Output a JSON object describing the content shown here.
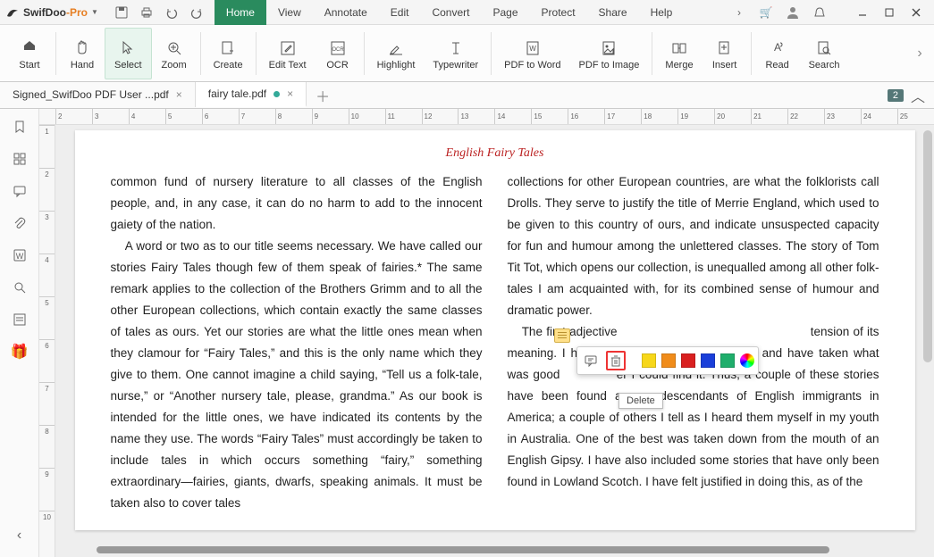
{
  "app": {
    "name1": "SwifDoo",
    "name2": "-Pro"
  },
  "menu": [
    "Home",
    "View",
    "Annotate",
    "Edit",
    "Convert",
    "Page",
    "Protect",
    "Share",
    "Help"
  ],
  "menu_active": 0,
  "ribbon": [
    {
      "label": "Start",
      "icon": "home"
    },
    {
      "label": "Hand",
      "icon": "hand"
    },
    {
      "label": "Select",
      "icon": "cursor",
      "selected": true
    },
    {
      "label": "Zoom",
      "icon": "zoom"
    },
    {
      "label": "Create",
      "icon": "create"
    },
    {
      "label": "Edit Text",
      "icon": "edittext"
    },
    {
      "label": "OCR",
      "icon": "ocr"
    },
    {
      "label": "Highlight",
      "icon": "highlight"
    },
    {
      "label": "Typewriter",
      "icon": "type"
    },
    {
      "label": "PDF to Word",
      "icon": "toword"
    },
    {
      "label": "PDF to Image",
      "icon": "toimg"
    },
    {
      "label": "Merge",
      "icon": "merge"
    },
    {
      "label": "Insert",
      "icon": "insert"
    },
    {
      "label": "Read",
      "icon": "read"
    },
    {
      "label": "Search",
      "icon": "search"
    }
  ],
  "tabs": [
    {
      "label": "Signed_SwifDoo PDF User ...pdf",
      "modified": false,
      "active": false
    },
    {
      "label": "fairy tale.pdf",
      "modified": true,
      "active": true
    }
  ],
  "tab_badge": "2",
  "ruler_h": [
    "2",
    "3",
    "4",
    "5",
    "6",
    "7",
    "8",
    "9",
    "10",
    "11",
    "12",
    "13",
    "14",
    "15",
    "16",
    "17",
    "18",
    "19",
    "20",
    "21",
    "22",
    "23",
    "24",
    "25"
  ],
  "ruler_v": [
    "1",
    "2",
    "3",
    "4",
    "5",
    "6",
    "7",
    "8",
    "9",
    "10"
  ],
  "doc": {
    "title": "English Fairy Tales",
    "col1_p1": "common fund of nursery literature to all classes of the English people, and, in any case, it can do no harm to add to the innocent gaiety of the nation.",
    "col1_p2": "A word or two as to our title seems necessary. We have called our stories Fairy Tales though few of them speak of fairies.* The same remark applies to the collection of the Brothers Grimm and to all the other European collections, which contain exactly the same classes of tales as ours. Yet our stories are what the little ones mean when they clamour for “Fairy Tales,” and this is the only name which they give to them. One cannot imagine a child saying, “Tell us a folk-tale, nurse,” or “Another nursery tale, please, grandma.” As our book is intended for the little ones, we have indicated its contents by the name they use. The words “Fairy Tales” must accordingly be taken to include tales in which occurs something “fairy,” something extraordinary—fairies, giants, dwarfs, speaking animals. It must be taken also to cover tales",
    "col2_p1": "collections for other European countries, are what the folklorists call Drolls. They serve to justify the title of Merrie England, which used to be given to this country of ours, and indicate unsuspected capacity for fun and humour among the unlettered classes. The story of Tom Tit Tot, which opens our collection, is unequalled among all other folk-tales I am acquainted with, for its combined sense of humour and dramatic power.",
    "col2_p2a": "The first adjective",
    "col2_p2b": "tension of its meaning. I have acted on Moliere's principle, and have taken what was good",
    "col2_p2c": "er I could find it. Thus, a couple of these stories have been found among descendants of English immigrants in America; a couple of others I tell as I heard them myself in my youth in Australia. One of the best was taken down from the mouth of an English Gipsy. I have also included some stories that have only been found in Lowland Scotch. I have felt justified in doing this, as of the"
  },
  "annot_colors": [
    "#f7d71a",
    "#f08c1a",
    "#d92020",
    "#1a3fd9",
    "#1fae6b"
  ],
  "tooltip": "Delete"
}
